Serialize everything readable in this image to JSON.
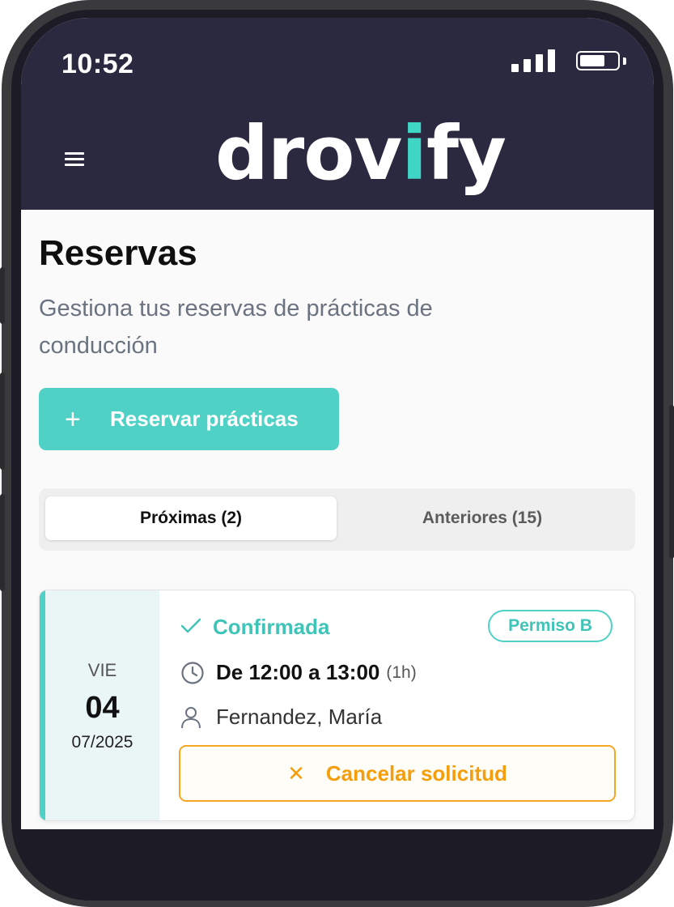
{
  "status_bar": {
    "time": "10:52"
  },
  "header": {
    "logo_text_start": "drov",
    "logo_text_accent": "i",
    "logo_text_end": "fy",
    "menu_icon": "hamburger-icon"
  },
  "page": {
    "title": "Reservas",
    "subtitle": "Gestiona tus reservas de prácticas de conducción",
    "primary_button": {
      "icon": "plus-icon",
      "label": "Reservar prácticas"
    }
  },
  "tabs": [
    {
      "label": "Próximas (2)",
      "active": true
    },
    {
      "label": "Anteriores (15)",
      "active": false
    }
  ],
  "bookings": [
    {
      "weekday": "VIE",
      "day": "04",
      "month_year": "07/2025",
      "status": "Confirmada",
      "license": "Permiso B",
      "time_range": "De 12:00 a 13:00",
      "duration": "(1h)",
      "instructor": "Fernandez, María",
      "cancel_label": "Cancelar solicitud"
    }
  ],
  "colors": {
    "header_bg": "#2b2940",
    "accent": "#4fd1c5",
    "warning": "#f59e0b",
    "muted_text": "#6b7280"
  }
}
